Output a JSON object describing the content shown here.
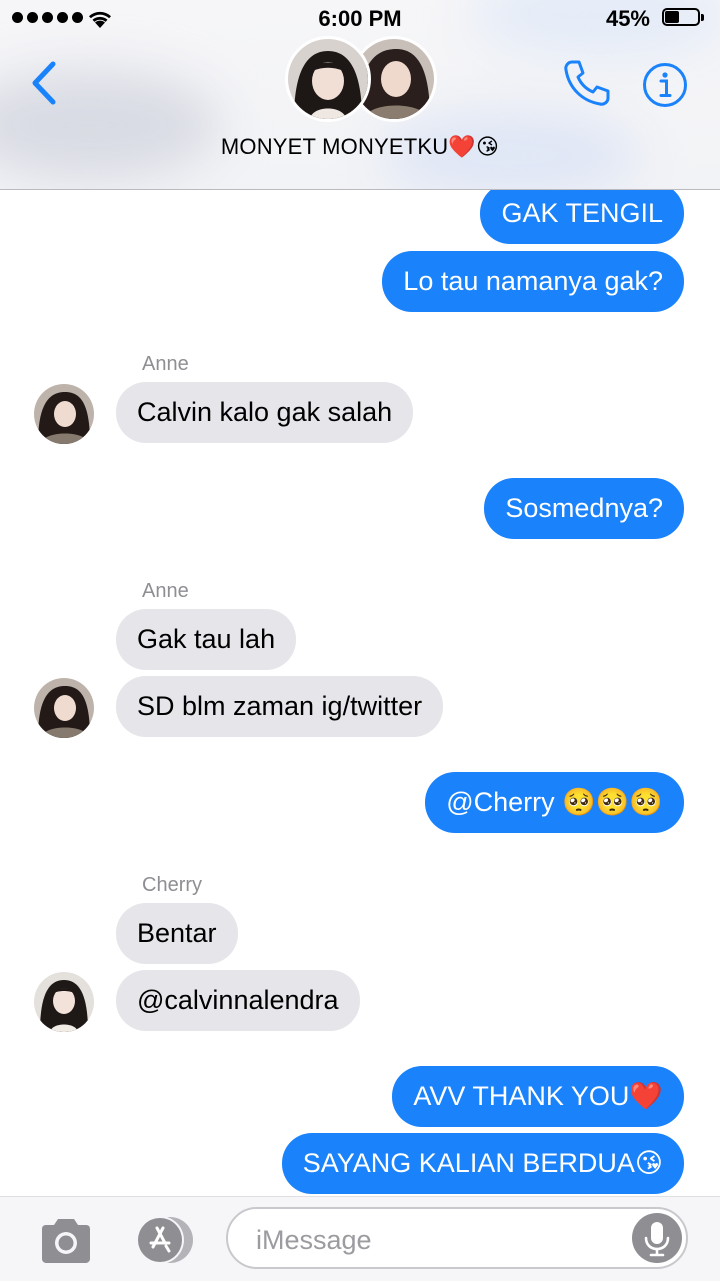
{
  "status_bar": {
    "time": "6:00 PM",
    "battery_percent": "45%",
    "battery_level": 0.45,
    "signal_bars": 5
  },
  "header": {
    "group_name": "MONYET MONYETKU❤️😘",
    "back_icon": "chevron-left-icon",
    "phone_icon": "phone-icon",
    "info_icon": "info-icon"
  },
  "messages": [
    {
      "direction": "out",
      "text": "GAK TENGIL"
    },
    {
      "direction": "out",
      "text": "Lo tau namanya gak?"
    },
    {
      "direction": "in",
      "sender": "Anne",
      "text": "Calvin kalo gak salah"
    },
    {
      "direction": "out",
      "text": "Sosmednya?"
    },
    {
      "direction": "in",
      "sender": "Anne",
      "text": "Gak tau lah"
    },
    {
      "direction": "in",
      "text": "SD blm zaman ig/twitter"
    },
    {
      "direction": "out",
      "text": "@Cherry 🥺🥺🥺"
    },
    {
      "direction": "in",
      "sender": "Cherry",
      "text": "Bentar"
    },
    {
      "direction": "in",
      "text": "@calvinnalendra"
    },
    {
      "direction": "out",
      "text": "AVV THANK YOU❤️"
    },
    {
      "direction": "out",
      "text": "SAYANG KALIAN BERDUA😘"
    }
  ],
  "input_bar": {
    "placeholder": "iMessage",
    "camera_icon": "camera-icon",
    "apps_icon": "app-store-icon",
    "mic_icon": "microphone-icon"
  },
  "colors": {
    "outgoing_bubble": "#1a82fb",
    "incoming_bubble": "#e5e5ea",
    "accent": "#1a82fb"
  }
}
